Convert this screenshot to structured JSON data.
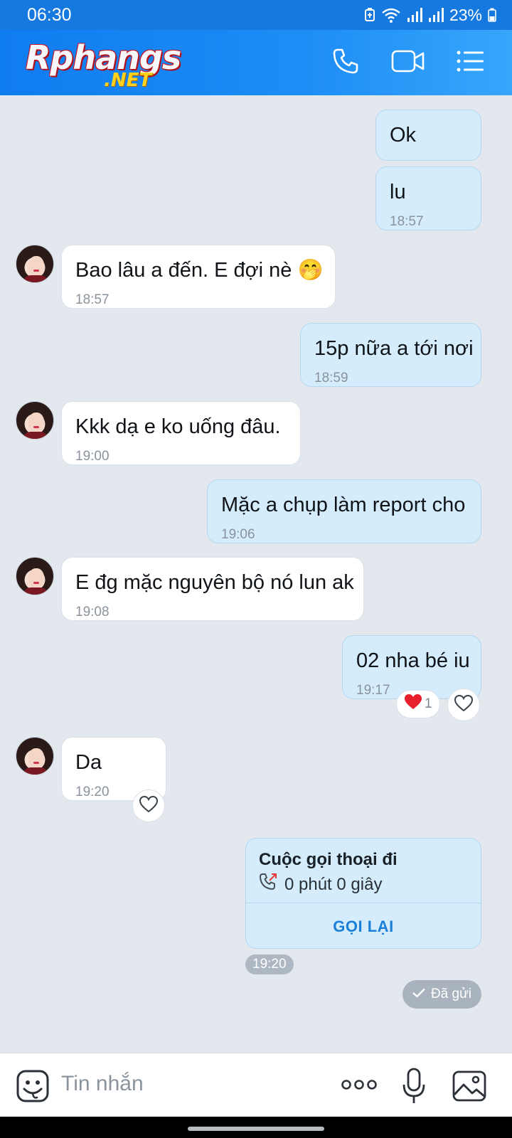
{
  "status": {
    "time": "06:30",
    "battery": "23%"
  },
  "header": {
    "logo_main": "Rphangs",
    "logo_sub": ".NET",
    "icons": [
      "phone-icon",
      "video-call-icon",
      "menu-list-icon"
    ]
  },
  "messages": [
    {
      "side": "me",
      "text": "Ok",
      "time": ""
    },
    {
      "side": "me",
      "text": "lu",
      "time": "18:57"
    },
    {
      "side": "them",
      "text": "Bao lâu a đến.  E đợi nè 🤭",
      "time": "18:57"
    },
    {
      "side": "me",
      "text": "15p nữa a tới nơi",
      "time": "18:59"
    },
    {
      "side": "them",
      "text": "Kkk dạ e ko uống đâu.",
      "time": "19:00"
    },
    {
      "side": "me",
      "text": "Mặc a chụp làm report cho",
      "time": "19:06"
    },
    {
      "side": "them",
      "text": "E đg mặc nguyên bộ nó lun ak",
      "time": "19:08"
    },
    {
      "side": "me",
      "text": "02 nha bé iu",
      "time": "19:17",
      "reaction_count": "1"
    },
    {
      "side": "them",
      "text": "Da",
      "time": "19:20"
    }
  ],
  "call_card": {
    "title": "Cuộc gọi thoại đi",
    "duration": "0 phút 0 giây",
    "action": "GỌI LẠI",
    "time": "19:20"
  },
  "sent_status": "Đã gửi",
  "composer": {
    "placeholder": "Tin nhắn"
  },
  "colors": {
    "header": "#1679e0",
    "my_bubble": "#d4ecfc",
    "their_bubble": "#ffffff",
    "background": "#e3e8ef",
    "accent": "#1a7fd6"
  }
}
